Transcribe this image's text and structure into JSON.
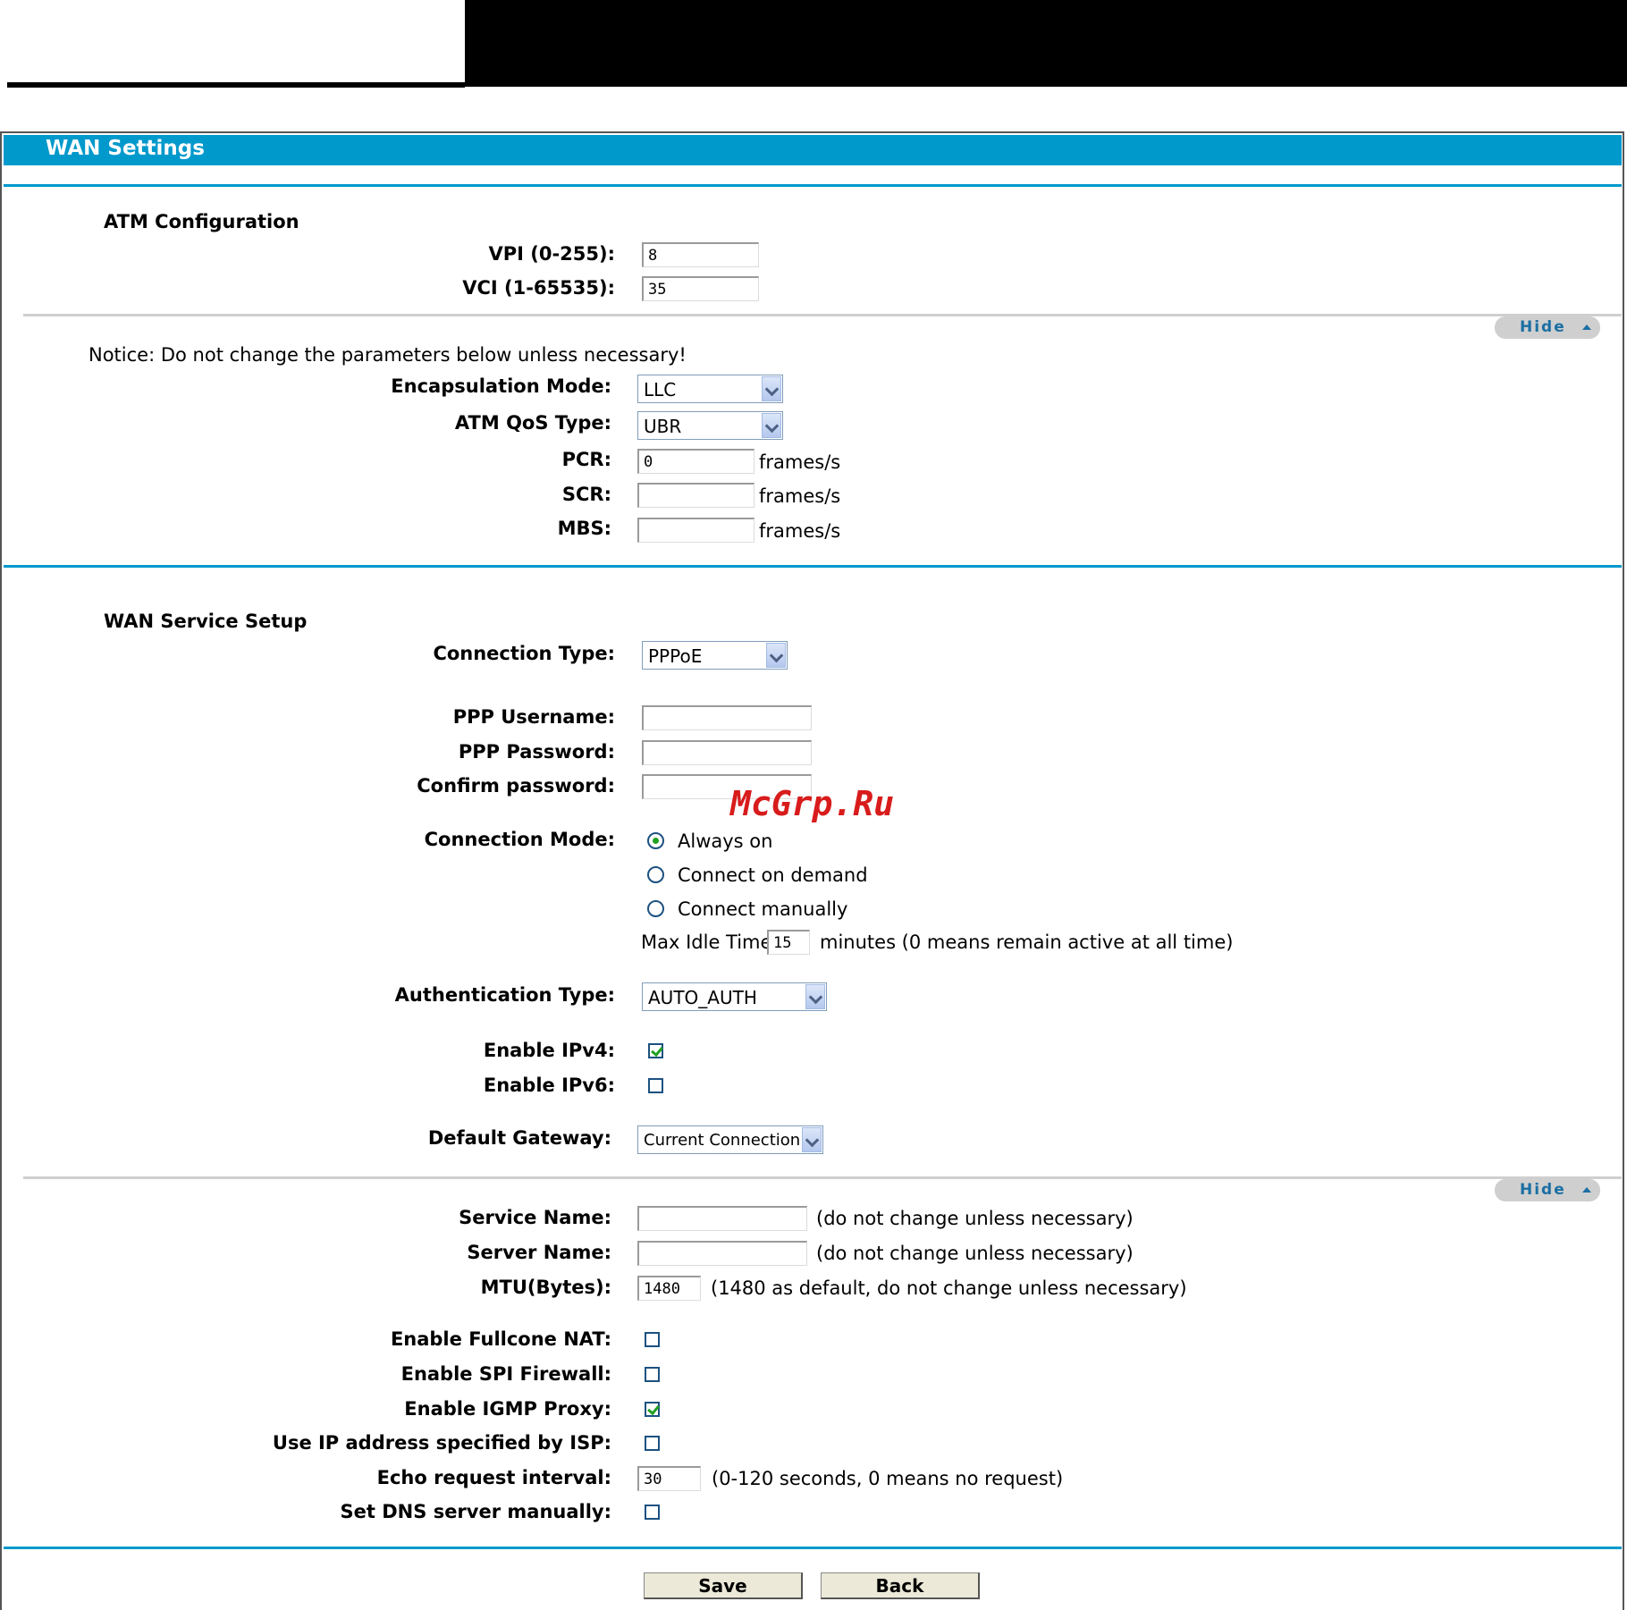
{
  "header": {
    "title": "WAN Settings"
  },
  "atm": {
    "section_title": "ATM Configuration",
    "vpi_label": "VPI (0-255):",
    "vpi_value": "8",
    "vci_label": "VCI (1-65535):",
    "vci_value": "35"
  },
  "advanced1": {
    "hide_label": "Hide",
    "notice": "Notice: Do not change the parameters below unless necessary!",
    "encap_label": "Encapsulation Mode:",
    "encap_value": "LLC",
    "qos_label": "ATM QoS Type:",
    "qos_value": "UBR",
    "pcr_label": "PCR:",
    "pcr_value": "0",
    "pcr_unit": "frames/s",
    "scr_label": "SCR:",
    "scr_value": "",
    "scr_unit": "frames/s",
    "mbs_label": "MBS:",
    "mbs_value": "",
    "mbs_unit": "frames/s"
  },
  "wan": {
    "section_title": "WAN Service Setup",
    "conn_type_label": "Connection Type:",
    "conn_type_value": "PPPoE",
    "ppp_user_label": "PPP Username:",
    "ppp_pass_label": "PPP Password:",
    "confirm_label": "Confirm password:",
    "watermark": "McGrp.Ru",
    "conn_mode_label": "Connection Mode:",
    "mode_always": "Always on",
    "mode_demand": "Connect on demand",
    "mode_manual": "Connect manually",
    "idle_label": "Max Idle Time:",
    "idle_value": "15",
    "idle_note": "minutes (0 means remain active at all time)",
    "auth_label": "Authentication Type:",
    "auth_value": "AUTO_AUTH",
    "ipv4_label": "Enable IPv4:",
    "ipv4_checked": true,
    "ipv6_label": "Enable IPv6:",
    "ipv6_checked": false,
    "gateway_label": "Default Gateway:",
    "gateway_value": "Current Connection"
  },
  "advanced2": {
    "hide_label": "Hide",
    "service_label": "Service Name:",
    "service_note": "(do not change unless necessary)",
    "server_label": "Server Name:",
    "server_note": "(do not change unless necessary)",
    "mtu_label": "MTU(Bytes):",
    "mtu_value": "1480",
    "mtu_note": "(1480 as default, do not change unless necessary)",
    "fullcone_label": "Enable Fullcone NAT:",
    "fullcone_checked": false,
    "spi_label": "Enable SPI Firewall:",
    "spi_checked": false,
    "igmp_label": "Enable IGMP Proxy:",
    "igmp_checked": true,
    "isp_ip_label": "Use IP address specified by ISP:",
    "isp_ip_checked": false,
    "echo_label": "Echo request interval:",
    "echo_value": "30",
    "echo_note": "(0-120 seconds, 0 means no request)",
    "dns_label": "Set DNS server manually:",
    "dns_checked": false
  },
  "footer": {
    "save_label": "Save",
    "back_label": "Back"
  },
  "colors": {
    "accent": "#0099cc",
    "check": "#21a121",
    "hide_text": "#1b6fa3"
  }
}
